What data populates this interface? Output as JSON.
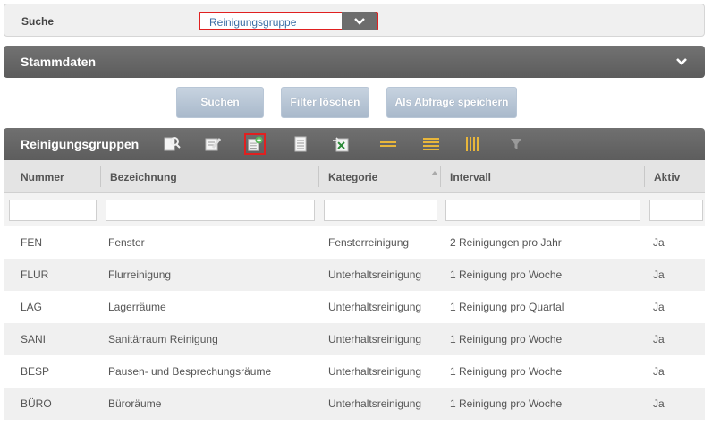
{
  "search": {
    "label": "Suche",
    "selected": "Reinigungsgruppe"
  },
  "stammdaten": {
    "title": "Stammdaten"
  },
  "buttons": {
    "search": "Suchen",
    "clear": "Filter löschen",
    "save_query": "Als Abfrage speichern"
  },
  "grid": {
    "title": "Reinigungsgruppen",
    "columns": [
      "Nummer",
      "Bezeichnung",
      "Kategorie",
      "Intervall",
      "Aktiv"
    ],
    "rows": [
      [
        "FEN",
        "Fenster",
        "Fensterreinigung",
        "2 Reinigungen pro Jahr",
        "Ja"
      ],
      [
        "FLUR",
        "Flurreinigung",
        "Unterhaltsreinigung",
        "1 Reinigung pro Woche",
        "Ja"
      ],
      [
        "LAG",
        "Lagerräume",
        "Unterhaltsreinigung",
        "1 Reinigung pro Quartal",
        "Ja"
      ],
      [
        "SANI",
        "Sanitärraum Reinigung",
        "Unterhaltsreinigung",
        "1 Reinigung pro Woche",
        "Ja"
      ],
      [
        "BESP",
        "Pausen- und Besprechungsräume",
        "Unterhaltsreinigung",
        "1 Reinigung pro Woche",
        "Ja"
      ],
      [
        "BÜRO",
        "Büroräume",
        "Unterhaltsreinigung",
        "1 Reinigung pro Woche",
        "Ja"
      ]
    ]
  },
  "icons": [
    "search-doc-icon",
    "edit-doc-icon",
    "add-doc-icon",
    "document-icon",
    "excel-export-icon",
    "compact-view-icon",
    "rows-view-icon",
    "columns-icon",
    "filter-icon",
    "chevron-down-icon",
    "sort-asc-icon"
  ]
}
